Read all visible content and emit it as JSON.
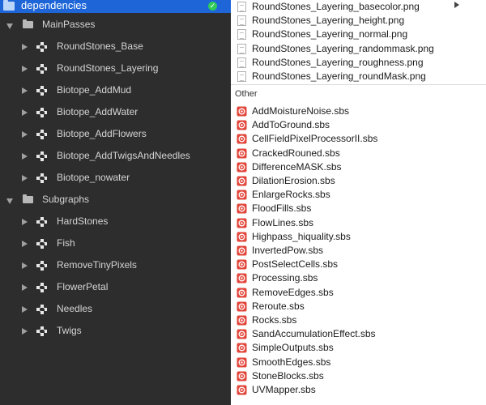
{
  "window": {
    "folder_title": "dependencies"
  },
  "colors": {
    "selection": "#1e66d8",
    "sidebar_bg": "#2d2d2d",
    "sbs_icon": "#e2453a",
    "check_badge": "#2fcc58"
  },
  "tree": {
    "groups": [
      {
        "label": "MainPasses",
        "expanded": true,
        "items": [
          {
            "label": "RoundStones_Base"
          },
          {
            "label": "RoundStones_Layering"
          },
          {
            "label": "Biotope_AddMud"
          },
          {
            "label": "Biotope_AddWater"
          },
          {
            "label": "Biotope_AddFlowers"
          },
          {
            "label": "Biotope_AddTwigsAndNeedles"
          },
          {
            "label": "Biotope_nowater"
          }
        ]
      },
      {
        "label": "Subgraphs",
        "expanded": true,
        "items": [
          {
            "label": "HardStones"
          },
          {
            "label": "Fish"
          },
          {
            "label": "RemoveTinyPixels"
          },
          {
            "label": "FlowerPetal"
          },
          {
            "label": "Needles"
          },
          {
            "label": "Twigs"
          }
        ]
      }
    ]
  },
  "images": [
    {
      "name": "RoundStones_Layering_basecolor.png"
    },
    {
      "name": "RoundStones_Layering_height.png"
    },
    {
      "name": "RoundStones_Layering_normal.png"
    },
    {
      "name": "RoundStones_Layering_randommask.png"
    },
    {
      "name": "RoundStones_Layering_roughness.png"
    },
    {
      "name": "RoundStones_Layering_roundMask.png"
    }
  ],
  "other": {
    "label": "Other",
    "files": [
      {
        "name": "AddMoistureNoise.sbs"
      },
      {
        "name": "AddToGround.sbs"
      },
      {
        "name": "CellFieldPixelProcessorII.sbs"
      },
      {
        "name": "CrackedRouned.sbs"
      },
      {
        "name": "DifferenceMASK.sbs"
      },
      {
        "name": "DilationErosion.sbs"
      },
      {
        "name": "EnlargeRocks.sbs"
      },
      {
        "name": "FloodFills.sbs"
      },
      {
        "name": "FlowLines.sbs"
      },
      {
        "name": "Highpass_hiquality.sbs"
      },
      {
        "name": "InvertedPow.sbs"
      },
      {
        "name": "PostSelectCells.sbs"
      },
      {
        "name": "Processing.sbs"
      },
      {
        "name": "RemoveEdges.sbs"
      },
      {
        "name": "Reroute.sbs"
      },
      {
        "name": "Rocks.sbs"
      },
      {
        "name": "SandAccumulationEffect.sbs"
      },
      {
        "name": "SimpleOutputs.sbs"
      },
      {
        "name": "SmoothEdges.sbs"
      },
      {
        "name": "StoneBlocks.sbs"
      },
      {
        "name": "UVMapper.sbs"
      }
    ]
  }
}
